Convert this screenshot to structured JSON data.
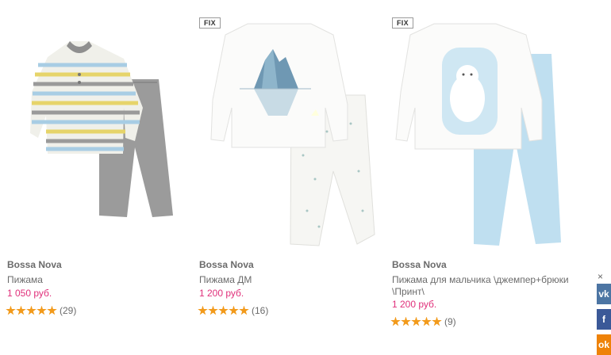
{
  "products": [
    {
      "brand": "Bossa Nova",
      "name": "Пижама",
      "price": "1 050 руб.",
      "rating": 5,
      "reviews": "(29)",
      "badge": ""
    },
    {
      "brand": "Bossa Nova",
      "name": "Пижама ДМ",
      "price": "1 200 руб.",
      "rating": 5,
      "reviews": "(16)",
      "badge": "FIX"
    },
    {
      "brand": "Bossa Nova",
      "name": "Пижама для мальчика \\джемпер+брюки \\Принт\\",
      "price": "1 200 руб.",
      "rating": 5,
      "reviews": "(9)",
      "badge": "FIX"
    }
  ],
  "share": {
    "close": "×",
    "vk": "vk",
    "fb": "f",
    "ok": "ok"
  },
  "colors": {
    "price": "#e0307a",
    "star": "#f29a1b",
    "brand": "#6b6b6b",
    "vk": "#4c75a3",
    "fb": "#3b5998",
    "ok": "#ee8208"
  }
}
